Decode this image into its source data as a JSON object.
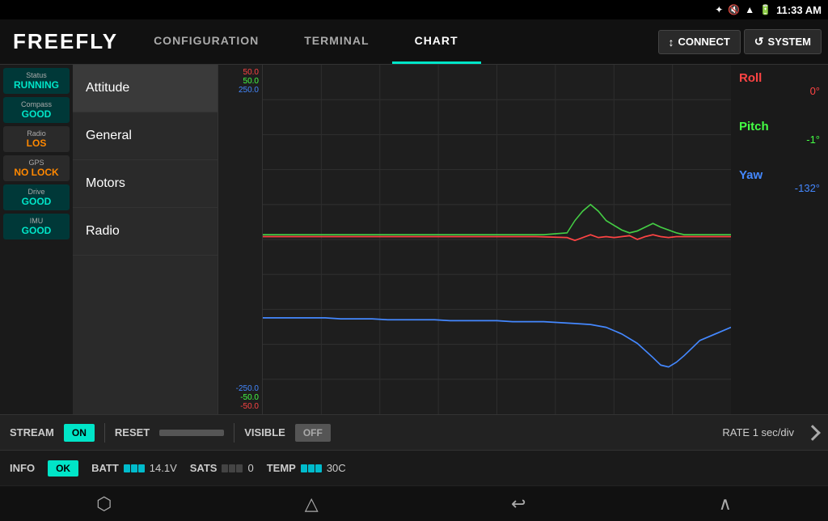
{
  "statusBar": {
    "time": "11:33 AM",
    "icons": [
      "bluetooth",
      "mute",
      "wifi",
      "battery"
    ]
  },
  "logo": "FREEFLY",
  "nav": {
    "tabs": [
      {
        "id": "configuration",
        "label": "CONFIGURATION",
        "active": false
      },
      {
        "id": "terminal",
        "label": "TERMINAL",
        "active": false
      },
      {
        "id": "chart",
        "label": "CHART",
        "active": true
      }
    ],
    "actions": [
      {
        "id": "connect",
        "label": "CONNECT",
        "icon": "↕"
      },
      {
        "id": "system",
        "label": "SYSTEM",
        "icon": "↺"
      }
    ]
  },
  "sidebar": {
    "items": [
      {
        "label": "Status",
        "value": "RUNNING",
        "state": "green"
      },
      {
        "label": "Compass",
        "value": "GOOD",
        "state": "green"
      },
      {
        "label": "Radio",
        "value": "LOS",
        "state": "gray"
      },
      {
        "label": "GPS",
        "value": "NO LOCK",
        "state": "gray"
      },
      {
        "label": "Drive",
        "value": "GOOD",
        "state": "green"
      },
      {
        "label": "IMU",
        "value": "GOOD",
        "state": "green"
      }
    ]
  },
  "navList": {
    "items": [
      {
        "label": "Attitude",
        "active": true
      },
      {
        "label": "General",
        "active": false
      },
      {
        "label": "Motors",
        "active": false
      },
      {
        "label": "Radio",
        "active": false
      }
    ]
  },
  "chart": {
    "yLabels": {
      "top": [
        "50.0",
        "50.0",
        "250.0"
      ],
      "bottom": [
        "-250.0",
        "-50.0",
        "-50.0"
      ]
    },
    "legend": {
      "items": [
        {
          "label": "Roll",
          "value": "0°",
          "color": "red"
        },
        {
          "label": "Pitch",
          "value": "-1°",
          "color": "green"
        },
        {
          "label": "Yaw",
          "value": "-132°",
          "color": "blue"
        }
      ]
    }
  },
  "toolbar": {
    "streamLabel": "STREAM",
    "streamState": "ON",
    "resetLabel": "RESET",
    "visibleLabel": "VISIBLE",
    "visibleState": "OFF",
    "rateLabel": "RATE 1 sec/div"
  },
  "infoBar": {
    "infoLabel": "INFO",
    "infoValue": "OK",
    "battLabel": "BATT",
    "battValue": "14.1V",
    "satsLabel": "SATS",
    "satsValue": "0",
    "tempLabel": "TEMP",
    "tempValue": "30C"
  },
  "androidNav": {
    "back": "⬡",
    "home": "△",
    "recent": "↩",
    "up": "∧"
  }
}
